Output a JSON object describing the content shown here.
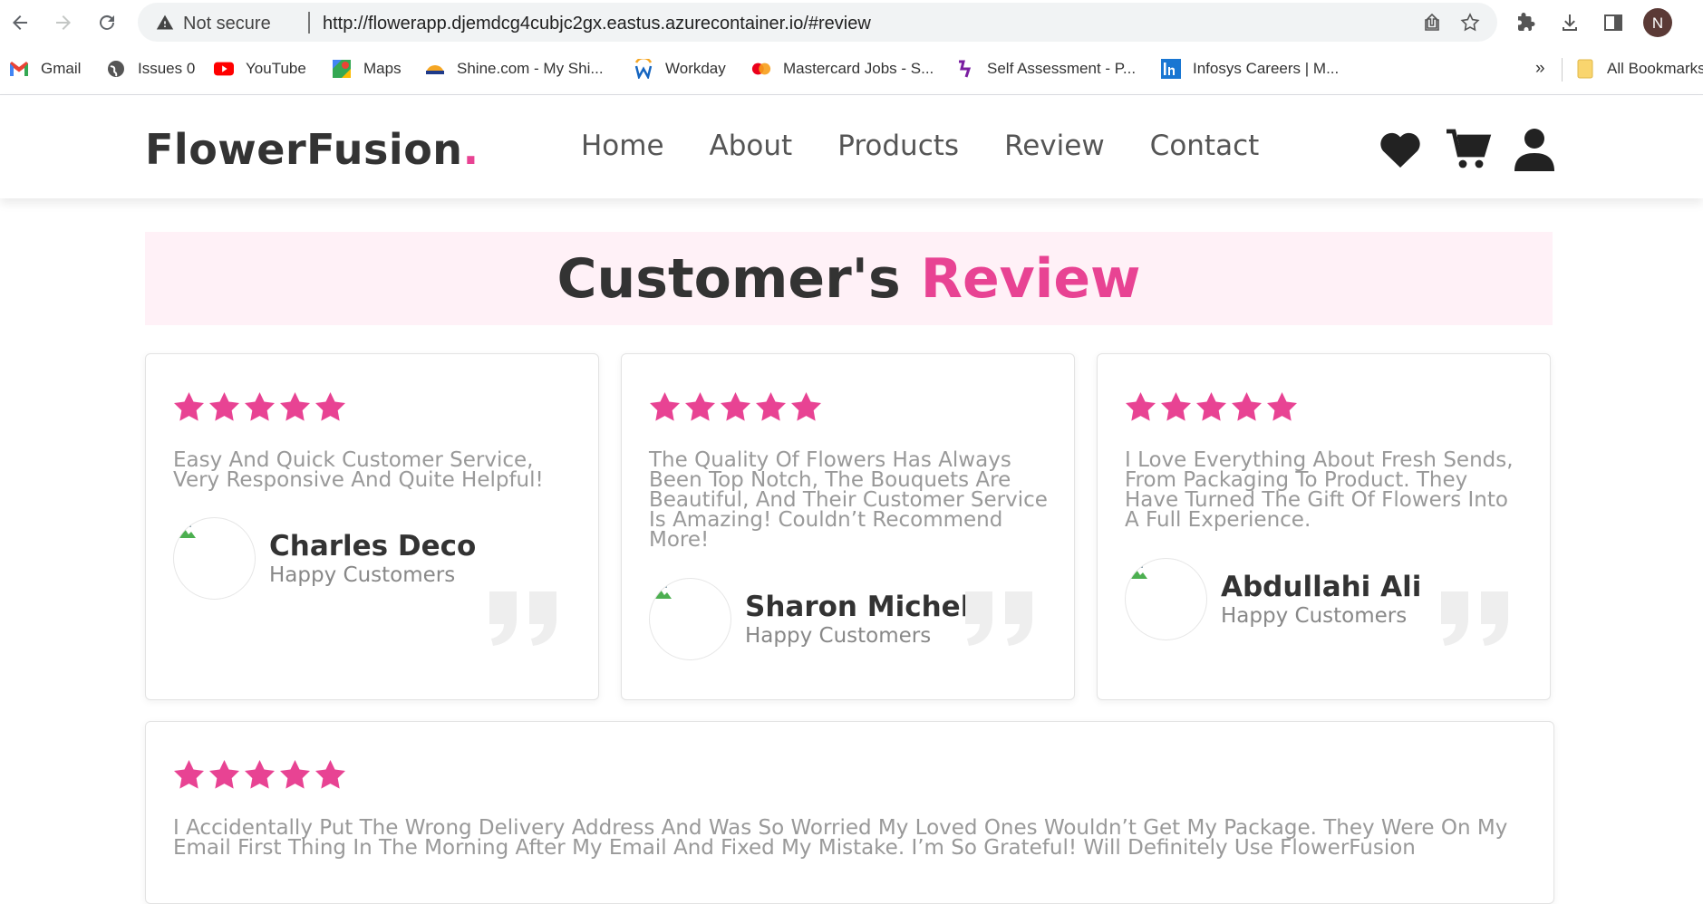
{
  "browser": {
    "security_label": "Not secure",
    "url": "http://flowerapp.djemdcg4cubjc2gx.eastus.azurecontainer.io/#review",
    "profile_initial": "N",
    "bookmarks": [
      {
        "label": "Gmail",
        "icon": "gmail-icon"
      },
      {
        "label": "Issues 0",
        "icon": "globe-icon"
      },
      {
        "label": "YouTube",
        "icon": "youtube-icon"
      },
      {
        "label": "Maps",
        "icon": "maps-icon"
      },
      {
        "label": "Shine.com - My Shi...",
        "icon": "shine-icon"
      },
      {
        "label": "Workday",
        "icon": "workday-icon"
      },
      {
        "label": "Mastercard Jobs - S...",
        "icon": "mastercard-icon"
      },
      {
        "label": "Self Assessment - P...",
        "icon": "self-assessment-icon"
      },
      {
        "label": "Infosys Careers | M...",
        "icon": "infosys-icon"
      }
    ],
    "overflow_label": "»",
    "all_bookmarks_label": "All Bookmarks"
  },
  "site": {
    "logo": "FlowerFusion",
    "logo_dot": ".",
    "nav": [
      "Home",
      "About",
      "Products",
      "Review",
      "Contact"
    ]
  },
  "section": {
    "title_main": "Customer's",
    "title_accent": "Review"
  },
  "reviews": [
    {
      "text": "Easy And Quick Customer Service, Very Responsive And Quite Helpful!",
      "name": "Charles Deco",
      "role": "Happy Customers",
      "rating": 5
    },
    {
      "text": "The Quality Of Flowers Has Always Been Top Notch, The Bouquets Are Beautiful, And Their Customer Service Is Amazing! Couldn’t Recommend More!",
      "name": "Sharon Michel",
      "role": "Happy Customers",
      "rating": 5
    },
    {
      "text": "I Love Everything About Fresh Sends, From Packaging To Product. They Have Turned The Gift Of Flowers Into A Full Experience.",
      "name": "Abdullahi Ali",
      "role": "Happy Customers",
      "rating": 5
    },
    {
      "text": "I Accidentally Put The Wrong Delivery Address And Was So Worried My Loved Ones Wouldn’t Get My Package. They Were On My Email First Thing In The Morning After My Email And Fixed My Mistake. I’m So Grateful! Will Definitely Use FlowerFusion",
      "rating": 5
    }
  ],
  "colors": {
    "accent": "#e84393",
    "text_dark": "#333333",
    "text_muted": "#999999",
    "band": "#fff1f7"
  }
}
